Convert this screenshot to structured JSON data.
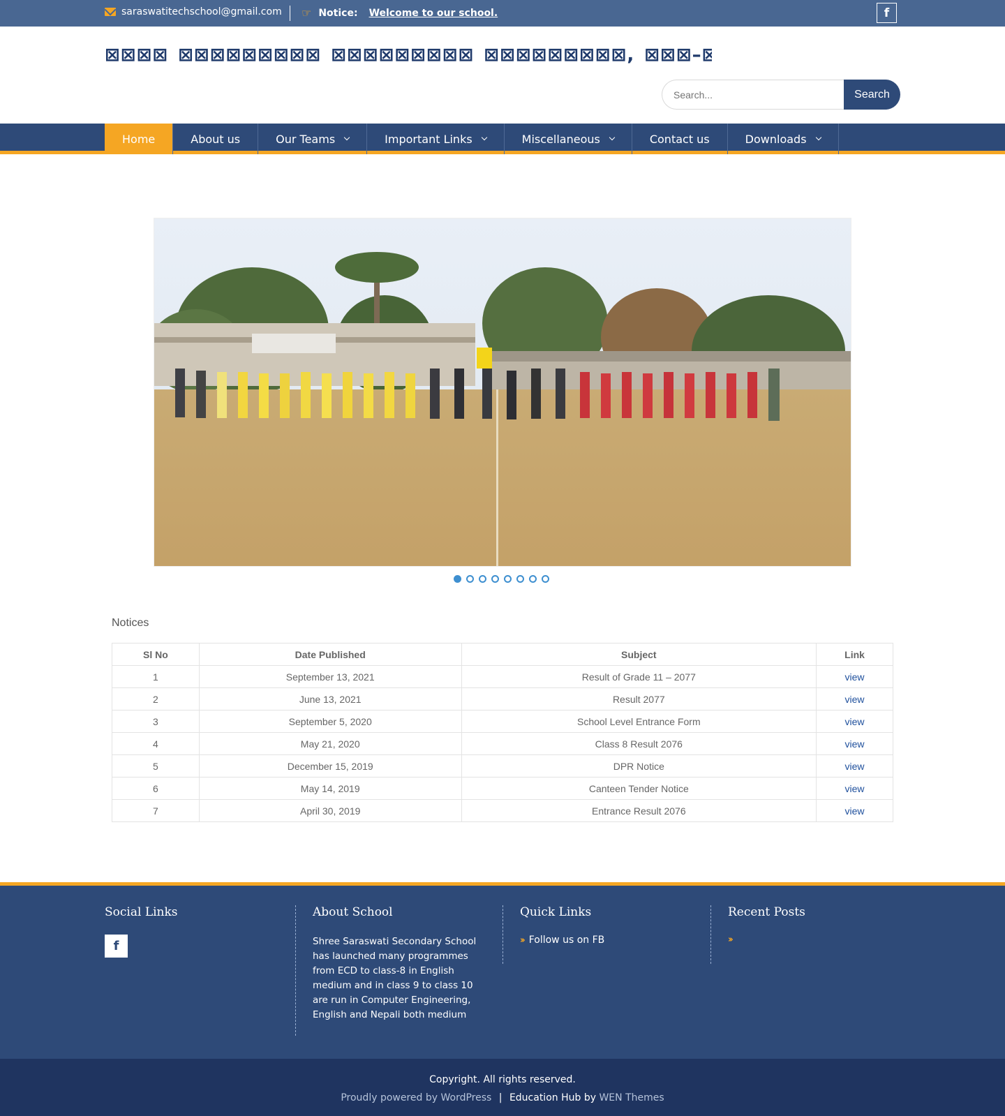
{
  "topbar": {
    "email": "saraswatitechschool@gmail.com",
    "notice_label": "Notice:",
    "notice_text": "Welcome to our school.",
    "facebook_glyph": "f"
  },
  "site": {
    "title_glyph_count": 35,
    "title_glyph": "⊠"
  },
  "search": {
    "placeholder": "Search...",
    "button": "Search"
  },
  "nav": {
    "items": [
      {
        "label": "Home",
        "dropdown": false,
        "active": true
      },
      {
        "label": "About us",
        "dropdown": false,
        "active": false
      },
      {
        "label": "Our Teams",
        "dropdown": true,
        "active": false
      },
      {
        "label": "Important Links",
        "dropdown": true,
        "active": false
      },
      {
        "label": "Miscellaneous",
        "dropdown": true,
        "active": false
      },
      {
        "label": "Contact us",
        "dropdown": false,
        "active": false
      },
      {
        "label": "Downloads",
        "dropdown": true,
        "active": false
      }
    ]
  },
  "slider": {
    "slide_count": 8,
    "active_index": 0
  },
  "notices": {
    "title": "Notices",
    "headers": [
      "Sl No",
      "Date Published",
      "Subject",
      "Link"
    ],
    "rows": [
      [
        "1",
        "September 13, 2021",
        "Result of Grade 11 – 2077",
        "view"
      ],
      [
        "2",
        "June 13, 2021",
        "Result 2077",
        "view"
      ],
      [
        "3",
        "September 5, 2020",
        "School Level Entrance Form",
        "view"
      ],
      [
        "4",
        "May 21, 2020",
        "Class 8 Result 2076",
        "view"
      ],
      [
        "5",
        "December 15, 2019",
        "DPR Notice",
        "view"
      ],
      [
        "6",
        "May 14, 2019",
        "Canteen Tender Notice",
        "view"
      ],
      [
        "7",
        "April 30, 2019",
        "Entrance Result 2076",
        "view"
      ]
    ]
  },
  "footer": {
    "social_title": "Social Links",
    "about_title": "About School",
    "about_text": "Shree Saraswati Secondary School has launched many programmes from ECD to class-8 in English medium and in class 9 to class 10 are run in Computer Engineering, English and Nepali both medium",
    "quick_title": "Quick Links",
    "quick_link": "Follow us on FB",
    "recent_title": "Recent Posts",
    "copyright": "Copyright. All rights reserved.",
    "powered_by": "Proudly powered by WordPress",
    "separator": "|",
    "theme_name": "Education Hub",
    "by": "by",
    "theme_author": "WEN Themes"
  },
  "colors": {
    "brand_blue": "#2e4a78",
    "topbar_blue": "#496792",
    "accent_orange": "#f5a623",
    "footer_dark": "#1f3460"
  }
}
